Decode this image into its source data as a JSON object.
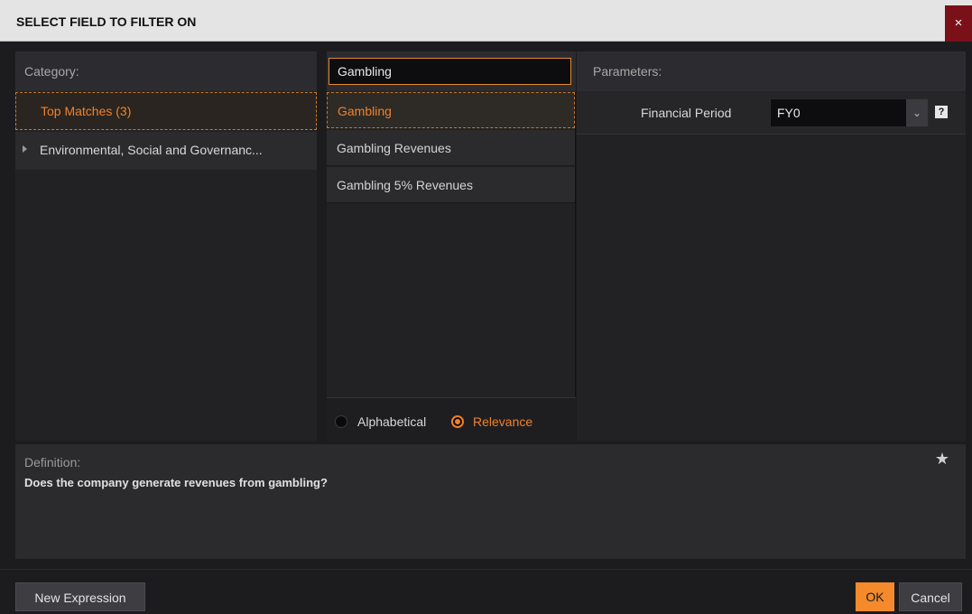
{
  "window": {
    "title": "SELECT FIELD TO FILTER ON",
    "close_label": "×"
  },
  "category_panel": {
    "header": "Category:",
    "items": [
      {
        "label": "Top Matches (3)",
        "selected": true
      },
      {
        "label": "Environmental, Social and Governanc...",
        "expandable": true
      }
    ]
  },
  "search": {
    "value": "Gambling"
  },
  "fields_panel": {
    "items": [
      {
        "label": "Gambling",
        "selected": true
      },
      {
        "label": "Gambling Revenues"
      },
      {
        "label": "Gambling 5% Revenues"
      }
    ],
    "sort_options": [
      {
        "label": "Alphabetical",
        "selected": false
      },
      {
        "label": "Relevance",
        "selected": true
      }
    ]
  },
  "parameters_panel": {
    "header": "Parameters:",
    "financial_period": {
      "label": "Financial Period",
      "value": "FY0",
      "help": "?"
    }
  },
  "definition": {
    "title": "Definition:",
    "text": "Does the company generate revenues from gambling?"
  },
  "footer": {
    "new_expression": "New Expression",
    "ok": "OK",
    "cancel": "Cancel"
  },
  "colors": {
    "accent": "#f0822a",
    "close": "#7a1018",
    "ok_button": "#f48a2c"
  }
}
